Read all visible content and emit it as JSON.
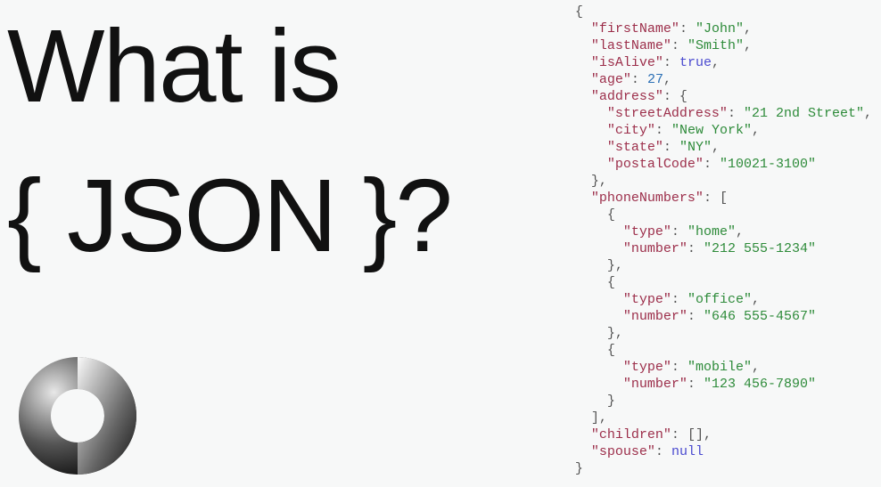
{
  "headline": {
    "line1": "What is",
    "line2": "{ JSON }?"
  },
  "logo": {
    "name": "json-logo-icon"
  },
  "code": {
    "firstName_key": "\"firstName\"",
    "firstName_val": "\"John\"",
    "lastName_key": "\"lastName\"",
    "lastName_val": "\"Smith\"",
    "isAlive_key": "\"isAlive\"",
    "isAlive_val": "true",
    "age_key": "\"age\"",
    "age_val": "27",
    "address_key": "\"address\"",
    "streetAddress_key": "\"streetAddress\"",
    "streetAddress_val": "\"21 2nd Street\"",
    "city_key": "\"city\"",
    "city_val": "\"New York\"",
    "state_key": "\"state\"",
    "state_val": "\"NY\"",
    "postalCode_key": "\"postalCode\"",
    "postalCode_val": "\"10021-3100\"",
    "phoneNumbers_key": "\"phoneNumbers\"",
    "type_key": "\"type\"",
    "number_key": "\"number\"",
    "type1_val": "\"home\"",
    "number1_val": "\"212 555-1234\"",
    "type2_val": "\"office\"",
    "number2_val": "\"646 555-4567\"",
    "type3_val": "\"mobile\"",
    "number3_val": "\"123 456-7890\"",
    "children_key": "\"children\"",
    "children_val": "[]",
    "spouse_key": "\"spouse\"",
    "spouse_val": "null"
  }
}
